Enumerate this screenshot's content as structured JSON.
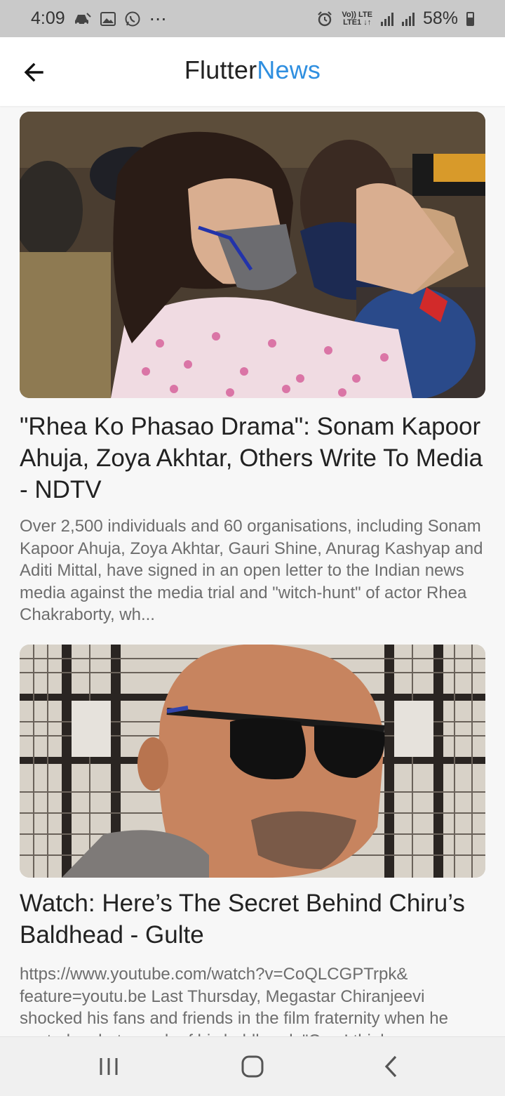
{
  "status_bar": {
    "time": "4:09",
    "notification_icons": [
      "car-icon",
      "image-icon",
      "whatsapp-icon",
      "more-icon"
    ],
    "more": "⋯",
    "volte_top": "Vo)) LTE",
    "volte_bottom": "LTE1 ↓↑",
    "battery": "58%"
  },
  "app_bar": {
    "title_part1": "Flutter",
    "title_part2": "News",
    "accent_color": "#2f8fe0"
  },
  "articles": [
    {
      "title": "\"Rhea Ko Phasao Drama\": Sonam Kapoor Ahuja, Zoya Akhtar, Others Write To Media - NDTV",
      "description": "Over 2,500 individuals and 60 organisations, including Sonam Kapoor Ahuja, Zoya Akhtar, Gauri Shine, Anurag Kashyap and Aditi Mittal, have signed in an open letter to the Indian news media against the media trial and \"witch-hunt\" of actor Rhea Chakraborty, wh..."
    },
    {
      "title": "Watch: Here’s The Secret Behind Chiru’s Baldhead - Gulte",
      "description": "https://www.youtube.com/watch?v=CoQLCGPTrpk& feature=youtu.be Last Thursday, Megastar Chiranjeevi shocked his fans and friends in the film fraternity when he posted a photograph of his baldhead. \"Can I think..."
    }
  ],
  "nav_bar": {
    "items": [
      "recents-icon",
      "home-icon",
      "back-icon"
    ]
  }
}
